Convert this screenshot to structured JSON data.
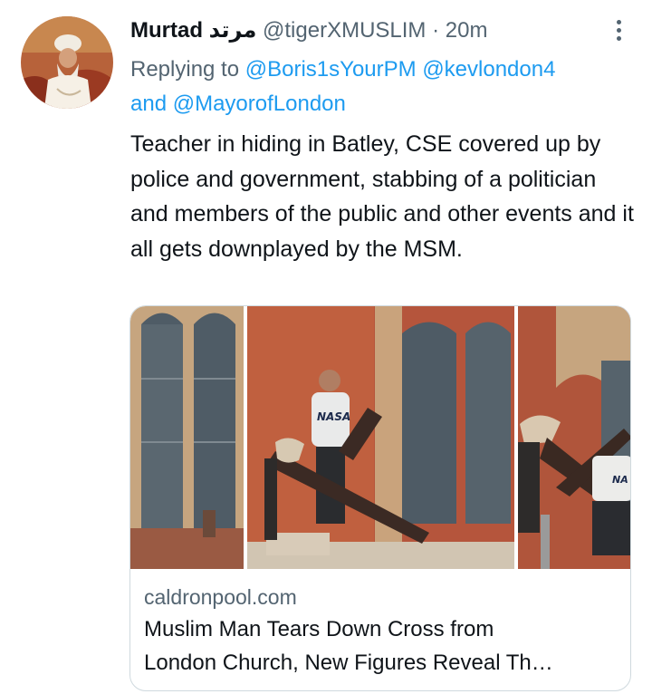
{
  "tweet": {
    "display_name": "Murtad",
    "display_name_arabic": "مرتد",
    "handle": "@tigerXMUSLIM",
    "separator": "·",
    "time": "20m",
    "replying_prefix": "Replying to",
    "mentions": [
      "@Boris1sYourPM",
      "@kevlondon4",
      "@MayorofLondon"
    ],
    "mention_joiner": "and",
    "text": "Teacher in hiding in Batley, CSE covered up by police and government, stabbing of a politician and members of the public and other events and it all gets downplayed by the MSM."
  },
  "link_card": {
    "domain": "caldronpool.com",
    "title_line1": "Muslim Man Tears Down Cross from",
    "title_line2": "London Church, New Figures Reveal Th…",
    "shirt_text": "NASA",
    "shirt_text_partial": "NA"
  },
  "icons": {
    "more": "more-horizontal-icon"
  },
  "colors": {
    "text": "#0f1419",
    "secondary": "#536471",
    "link": "#1d9bf0",
    "border": "#cfd9de"
  }
}
